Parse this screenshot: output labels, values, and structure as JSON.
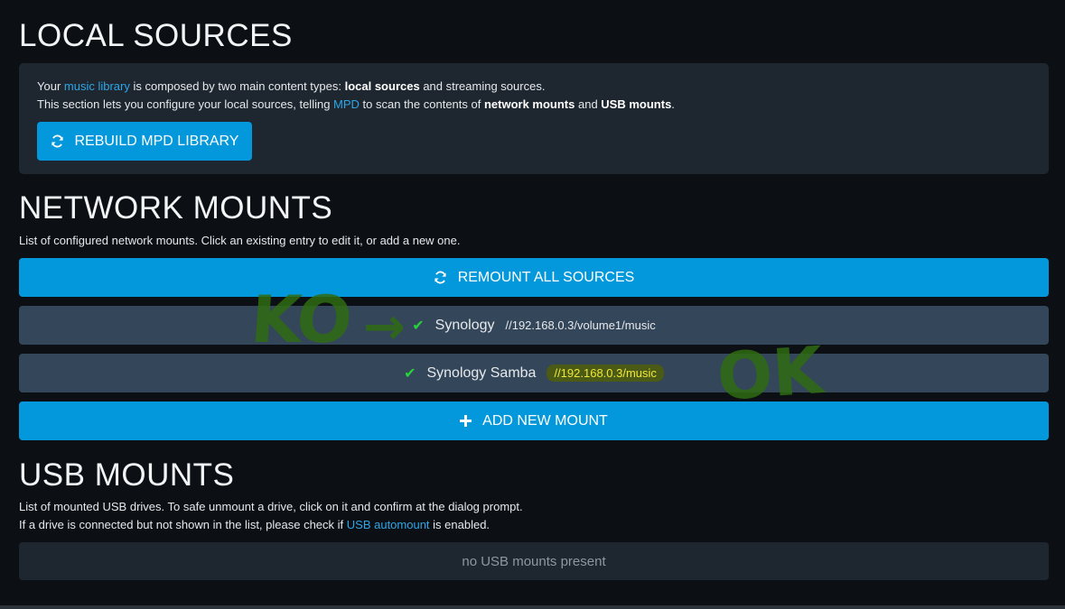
{
  "local": {
    "title": "LOCAL SOURCES",
    "line1": {
      "pre": "Your ",
      "link": "music library",
      "mid": " is composed by two main content types: ",
      "bold": "local sources",
      "post": " and streaming sources."
    },
    "line2": {
      "pre": "This section lets you configure your local sources, telling ",
      "link": "MPD",
      "mid": " to scan the contents of ",
      "bold1": "network mounts",
      "and": " and ",
      "bold2": "USB mounts",
      "post": "."
    },
    "rebuild_label": "REBUILD MPD LIBRARY"
  },
  "network": {
    "title": "NETWORK MOUNTS",
    "description": "List of configured network mounts. Click an existing entry to edit it, or add a new one.",
    "remount_label": "REMOUNT ALL SOURCES",
    "mounts": [
      {
        "name": "Synology",
        "path": "//192.168.0.3/volume1/music",
        "status_icon": "check-icon"
      },
      {
        "name": "Synology Samba",
        "path": "//192.168.0.3/music",
        "status_icon": "check-icon"
      }
    ],
    "add_label": "ADD NEW MOUNT"
  },
  "usb": {
    "title": "USB MOUNTS",
    "desc1": "List of mounted USB drives. To safe unmount a drive, click on it and confirm at the dialog prompt.",
    "desc2_pre": "If a drive is connected but not shown in the list, please check if ",
    "desc2_link": "USB automount",
    "desc2_post": " is enabled.",
    "empty": "no USB mounts present"
  },
  "annotations": {
    "ko": "KO",
    "arrow": "→",
    "ok": "OK"
  },
  "colors": {
    "accent": "#0398dc",
    "success": "#27d23b",
    "annotation": "#2f6b12",
    "highlight": "#f0e838"
  }
}
